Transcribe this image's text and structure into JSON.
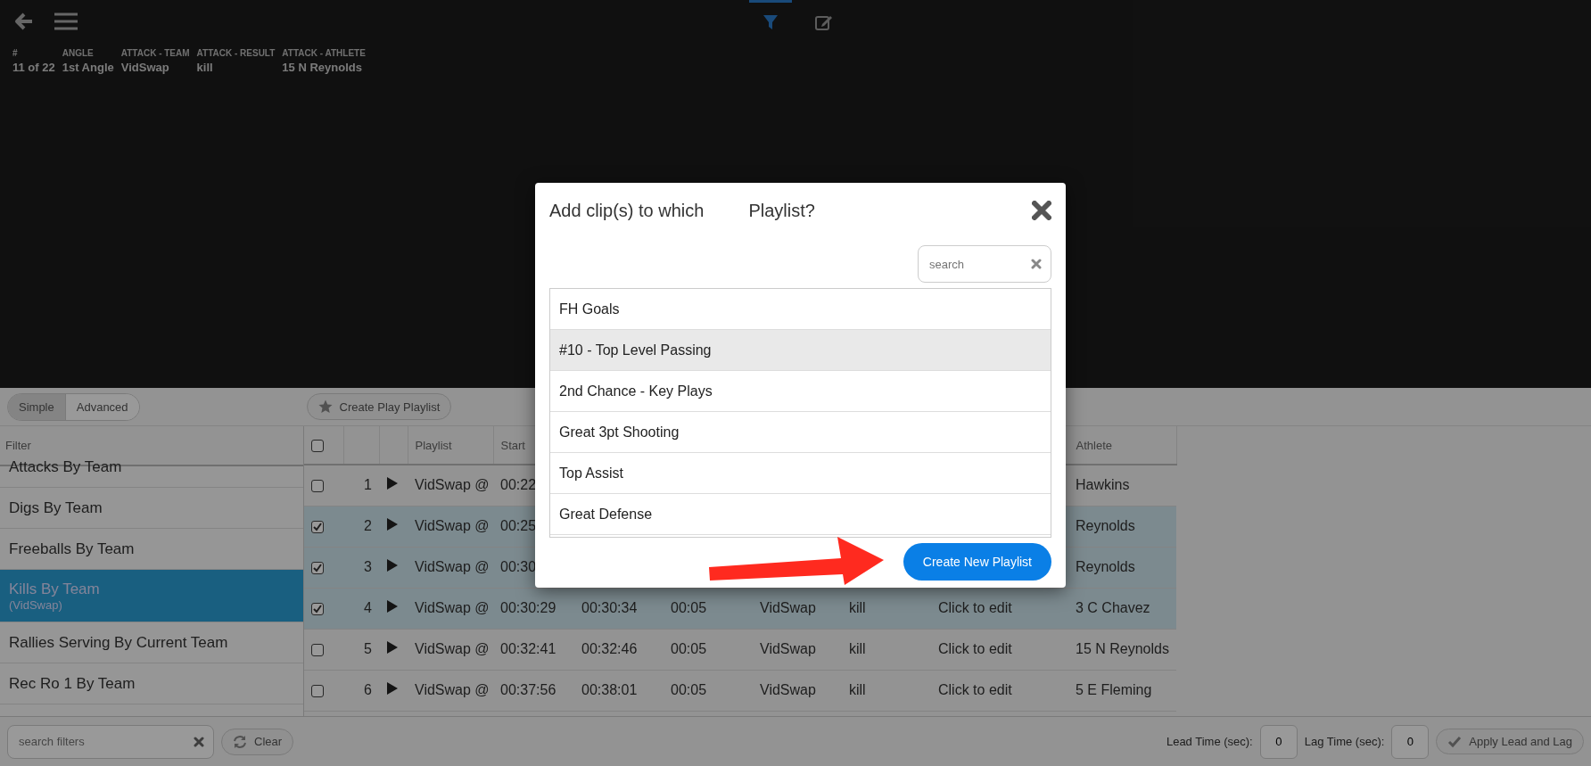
{
  "top_bar": {
    "tabs": [
      {
        "kind": "filter",
        "selected": true
      },
      {
        "kind": "edit",
        "selected": false
      }
    ]
  },
  "clip_info": [
    {
      "label": "#",
      "value": "11 of 22"
    },
    {
      "label": "ANGLE",
      "value": "1st Angle"
    },
    {
      "label": "ATTACK - TEAM",
      "value": "VidSwap"
    },
    {
      "label": "ATTACK - RESULT",
      "value": "kill"
    },
    {
      "label": "ATTACK - ATHLETE",
      "value": "15 N Reynolds"
    }
  ],
  "toolbar": {
    "modes": [
      {
        "label": "Simple",
        "selected": true
      },
      {
        "label": "Advanced",
        "selected": false
      }
    ],
    "create_button": "Create Play Playlist"
  },
  "sidebar": {
    "header": "Filter",
    "items": [
      {
        "label": "Attacks By Team",
        "selected": false
      },
      {
        "label": "Digs By Team",
        "selected": false
      },
      {
        "label": "Freeballs By Team",
        "selected": false
      },
      {
        "label": "Kills By Team",
        "sub": "(VidSwap)",
        "selected": true
      },
      {
        "label": "Rallies Serving By Current Team",
        "selected": false
      },
      {
        "label": "Rec Ro 1 By Team",
        "selected": false
      }
    ]
  },
  "table": {
    "header_checked": false,
    "columns": [
      {
        "label": "Playlist"
      },
      {
        "label": "Start"
      },
      {},
      {},
      {},
      {},
      {},
      {
        "label": "Athlete"
      }
    ],
    "rows": [
      {
        "number": "1",
        "checked": false,
        "cells": [
          "VidSwap @",
          "00:22",
          null,
          null,
          null,
          null,
          null,
          "Hawkins"
        ]
      },
      {
        "number": "2",
        "checked": true,
        "cells": [
          "VidSwap @",
          "00:25",
          null,
          null,
          null,
          null,
          null,
          "Reynolds"
        ]
      },
      {
        "number": "3",
        "checked": true,
        "cells": [
          "VidSwap @",
          "00:30",
          null,
          null,
          null,
          null,
          null,
          "Reynolds"
        ]
      },
      {
        "number": "4",
        "checked": true,
        "cells": [
          "VidSwap @",
          "00:30:29",
          "00:30:34",
          "00:05",
          "VidSwap",
          "kill",
          "Click to edit",
          "3 C Chavez"
        ]
      },
      {
        "number": "5",
        "checked": false,
        "cells": [
          "VidSwap @",
          "00:32:41",
          "00:32:46",
          "00:05",
          "VidSwap",
          "kill",
          "Click to edit",
          "15 N Reynolds"
        ]
      },
      {
        "number": "6",
        "checked": false,
        "cells": [
          "VidSwap @",
          "00:37:56",
          "00:38:01",
          "00:05",
          "VidSwap",
          "kill",
          "Click to edit",
          "5 E Fleming"
        ]
      }
    ]
  },
  "bottom_bar": {
    "search": {
      "placeholder": "search filters"
    },
    "clear": "Clear",
    "lead_label": "Lead Time (sec):",
    "lead_value": "0",
    "lag_label": "Lag Time (sec):",
    "lag_value": "0",
    "apply": "Apply Lead and Lag"
  },
  "modal": {
    "title": "Add clip(s) to which",
    "title_2": "Playlist?",
    "search": {
      "placeholder": "search"
    },
    "playlists": [
      {
        "label": "FH Goals",
        "highlighted": false
      },
      {
        "label": "#10 - Top Level Passing",
        "highlighted": true
      },
      {
        "label": "2nd Chance - Key Plays",
        "highlighted": false
      },
      {
        "label": "Great 3pt Shooting",
        "highlighted": false
      },
      {
        "label": "Top Assist",
        "highlighted": false
      },
      {
        "label": "Great Defense",
        "highlighted": false
      }
    ],
    "create_button": "Create New Playlist"
  }
}
